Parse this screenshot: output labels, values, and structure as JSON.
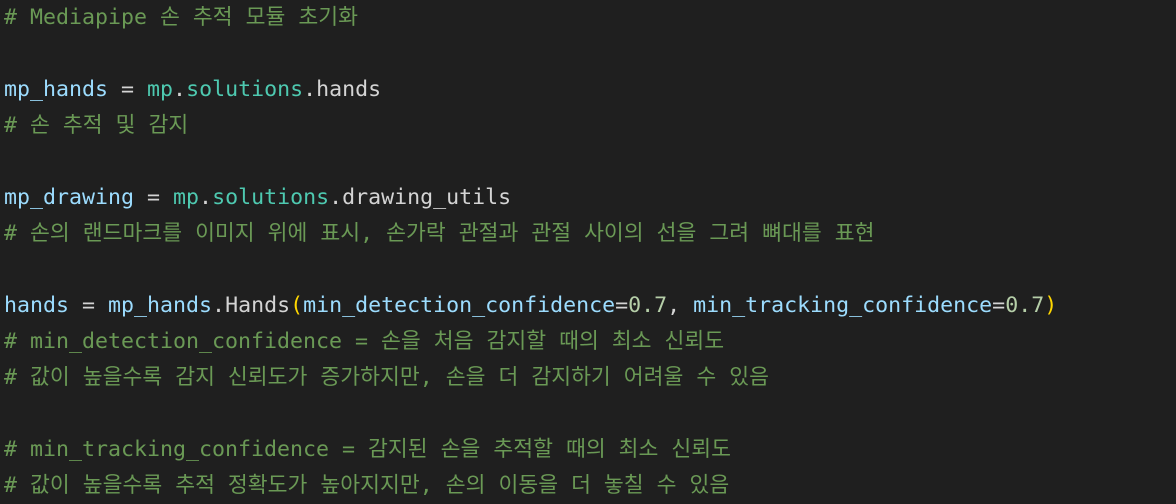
{
  "code": {
    "line1": "# Mediapipe 손 추적 모듈 초기화",
    "line2": {
      "var": "mp_hands",
      "eq": " = ",
      "mod_a": "mp",
      "dot1": ".",
      "mod_b": "solutions",
      "dot2": ".",
      "attr": "hands"
    },
    "line3": "# 손 추적 및 감지",
    "line4": {
      "var": "mp_drawing",
      "eq": " = ",
      "mod_a": "mp",
      "dot1": ".",
      "mod_b": "solutions",
      "dot2": ".",
      "attr": "drawing_utils"
    },
    "line5": "# 손의 랜드마크를 이미지 위에 표시, 손가락 관절과 관절 사이의 선을 그려 뼈대를 표현",
    "line6": {
      "var": "hands",
      "eq": " = ",
      "obj": "mp_hands",
      "dot": ".",
      "cls": "Hands",
      "open": "(",
      "p1": "min_detection_confidence",
      "eq1": "=",
      "v1": "0.7",
      "comma": ", ",
      "p2": "min_tracking_confidence",
      "eq2": "=",
      "v2": "0.7",
      "close": ")"
    },
    "line7": "# min_detection_confidence = 손을 처음 감지할 때의 최소 신뢰도",
    "line8": "# 값이 높을수록 감지 신뢰도가 증가하지만, 손을 더 감지하기 어려울 수 있음",
    "line9": "# min_tracking_confidence = 감지된 손을 추적할 때의 최소 신뢰도",
    "line10": "# 값이 높을수록 추적 정확도가 높아지지만, 손의 이동을 더 놓칠 수 있음"
  }
}
